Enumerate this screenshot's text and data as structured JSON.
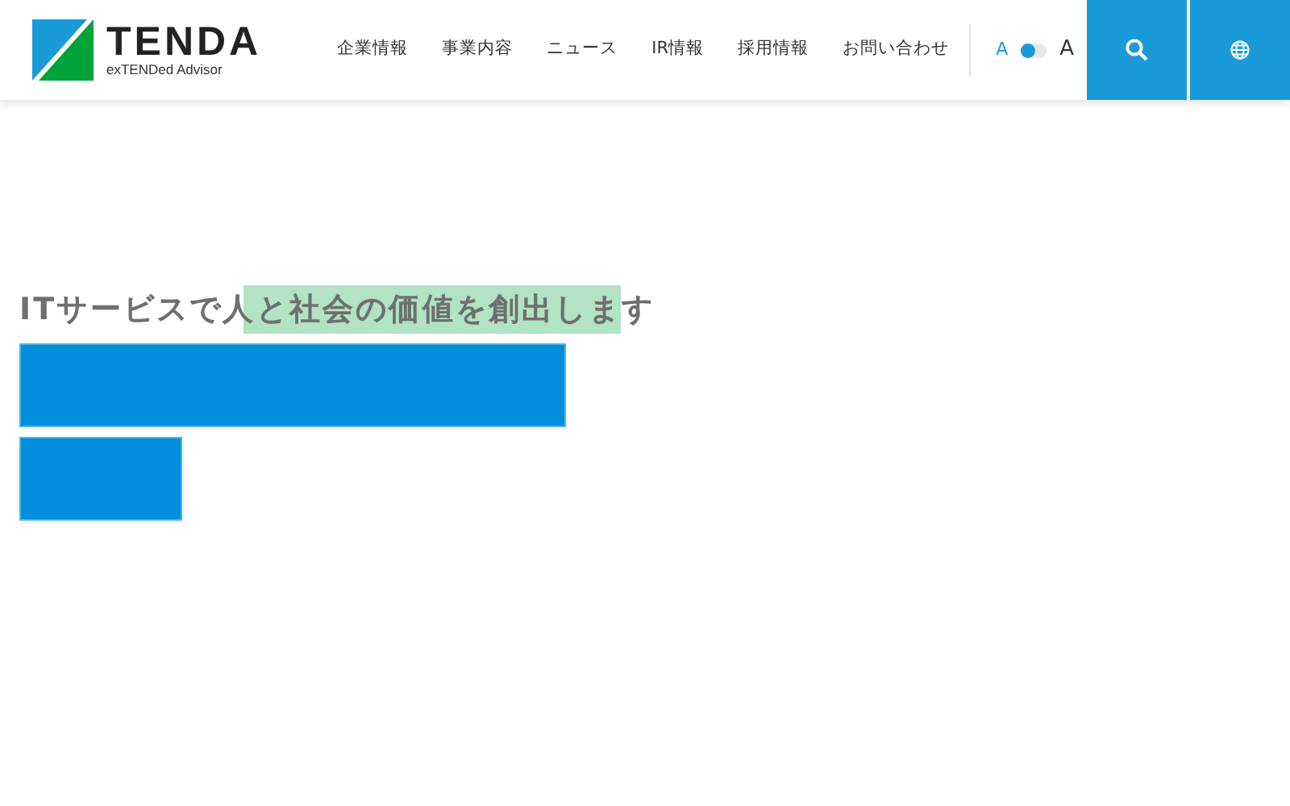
{
  "logo": {
    "name": "TENDA",
    "tagline": "exTENDed Advisor"
  },
  "nav": [
    "企業情報",
    "事業内容",
    "ニュース",
    "IR情報",
    "採用情報",
    "お問い合わせ"
  ],
  "font_size": [
    {
      "label": "A",
      "selected": true
    },
    {
      "label": "A",
      "selected": false
    }
  ],
  "hero": {
    "tagline": "ITサービスで人と社会の価値を創出します"
  }
}
